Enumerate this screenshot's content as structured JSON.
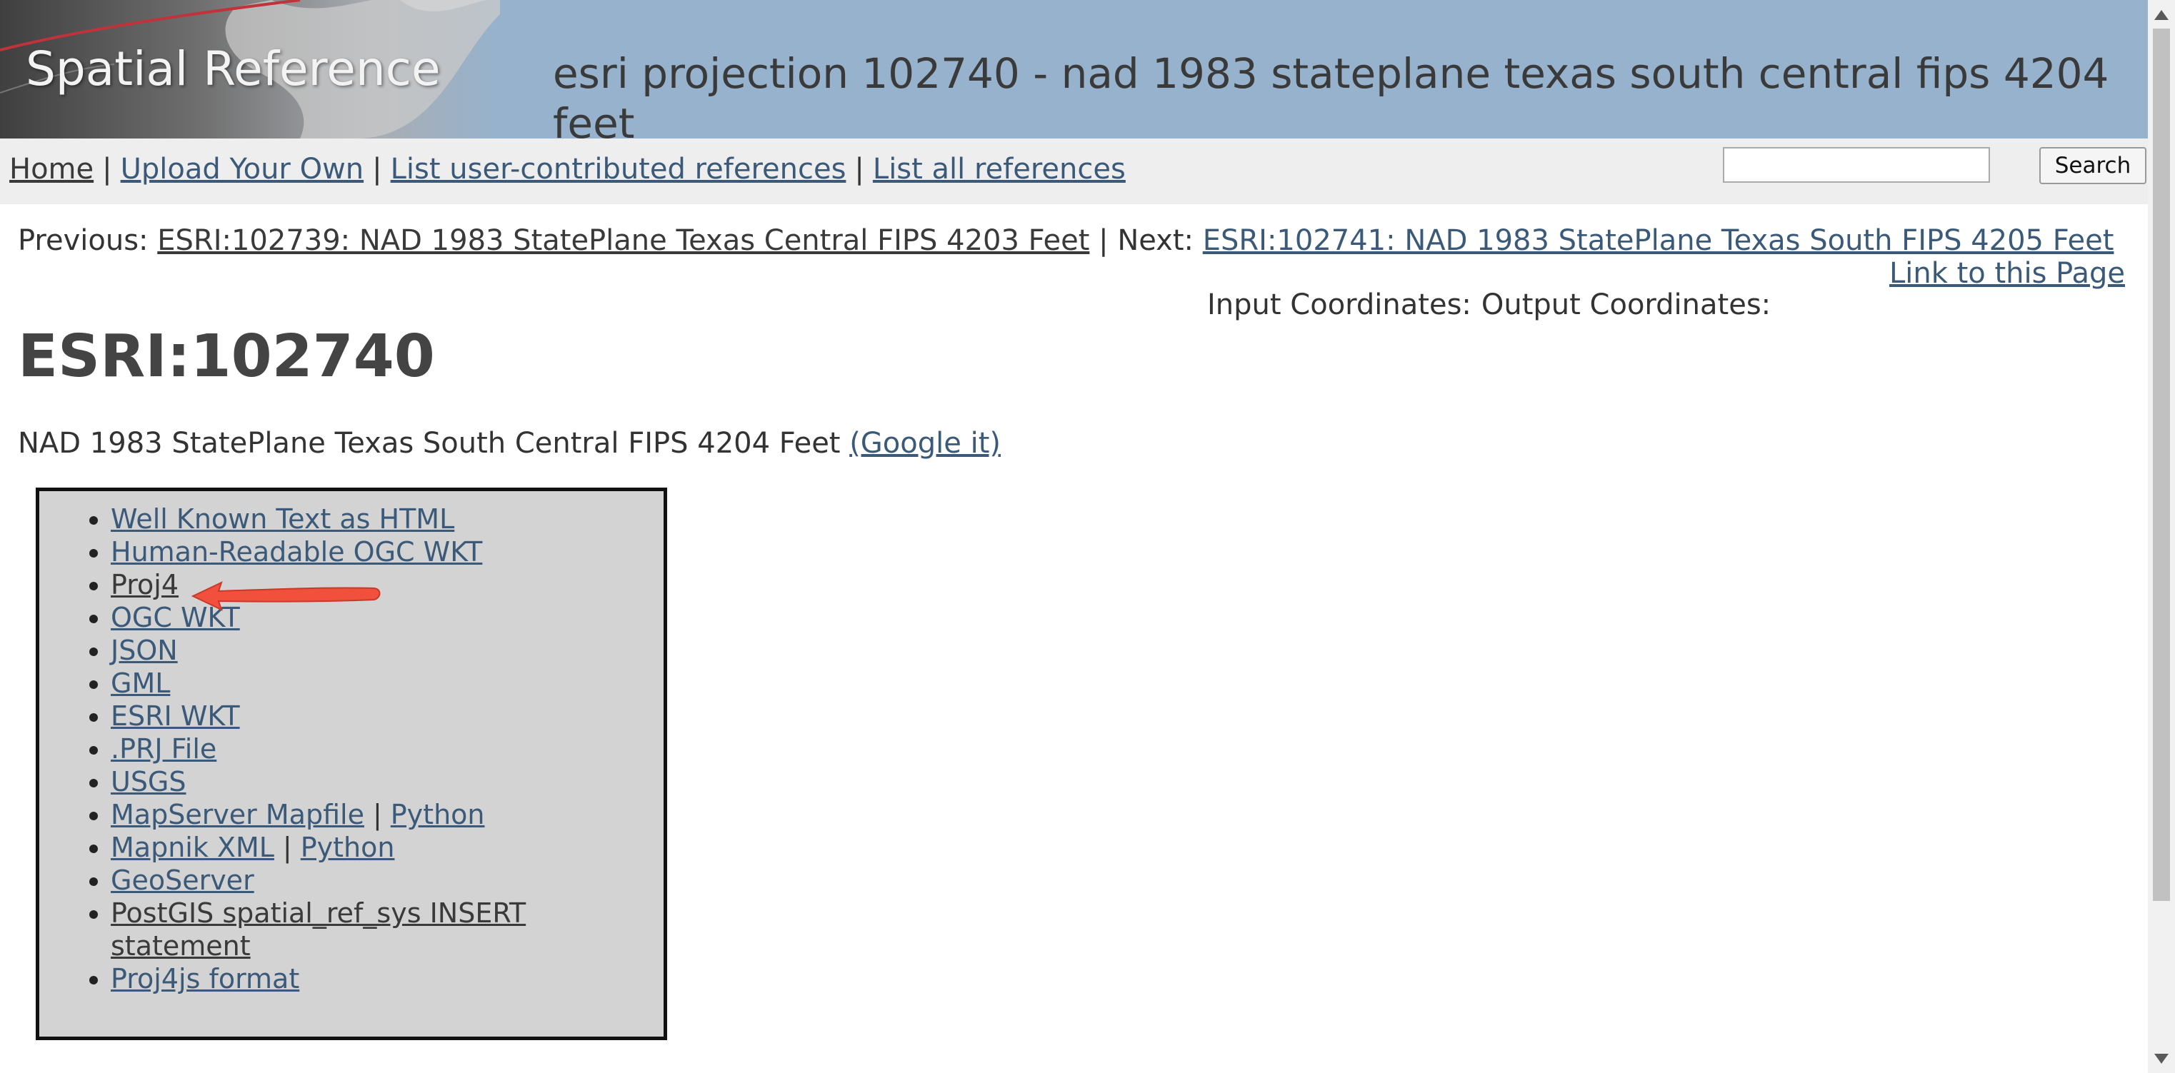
{
  "header": {
    "logo_text": "Spatial Reference",
    "heading": "esri projection 102740 - nad 1983 stateplane texas south central fips 4204 feet"
  },
  "nav": {
    "home": "Home",
    "upload": "Upload Your Own",
    "user_refs": "List user-contributed references",
    "all_refs": "List all references",
    "separator": "|"
  },
  "search": {
    "placeholder": "",
    "button_label": "Search"
  },
  "prevnext": {
    "prev_label": "Previous:",
    "prev_link": "ESRI:102739: NAD 1983 StatePlane Texas Central FIPS 4203 Feet",
    "separator": "|",
    "next_label": "Next:",
    "next_link": "ESRI:102741: NAD 1983 StatePlane Texas South FIPS 4205 Feet"
  },
  "link_to_page": "Link to this Page",
  "coords": {
    "input": "Input Coordinates:",
    "output": "Output Coordinates:"
  },
  "srid": {
    "title": "ESRI:102740",
    "description": "NAD 1983 StatePlane Texas South Central FIPS 4204 Feet",
    "google_link": "(Google it)"
  },
  "formats": {
    "items": [
      {
        "label": "Well Known Text as HTML"
      },
      {
        "label": "Human-Readable OGC WKT"
      },
      {
        "label": "Proj4"
      },
      {
        "label": "OGC WKT"
      },
      {
        "label": "JSON"
      },
      {
        "label": "GML"
      },
      {
        "label": "ESRI WKT"
      },
      {
        "label": ".PRJ File"
      },
      {
        "label": "USGS"
      },
      {
        "label": "MapServer Mapfile",
        "extra": "Python"
      },
      {
        "label": "Mapnik XML",
        "extra": "Python"
      },
      {
        "label": "GeoServer"
      },
      {
        "label": "PostGIS spatial_ref_sys INSERT statement"
      },
      {
        "label": "Proj4js format"
      }
    ]
  },
  "annotation": {
    "arrow_color": "#f0503c"
  },
  "colors": {
    "header_bg": "#96b2cd",
    "link": "#3b5a7a",
    "navbar_bg": "#eeeeee",
    "box_bg": "#d3d3d3"
  }
}
